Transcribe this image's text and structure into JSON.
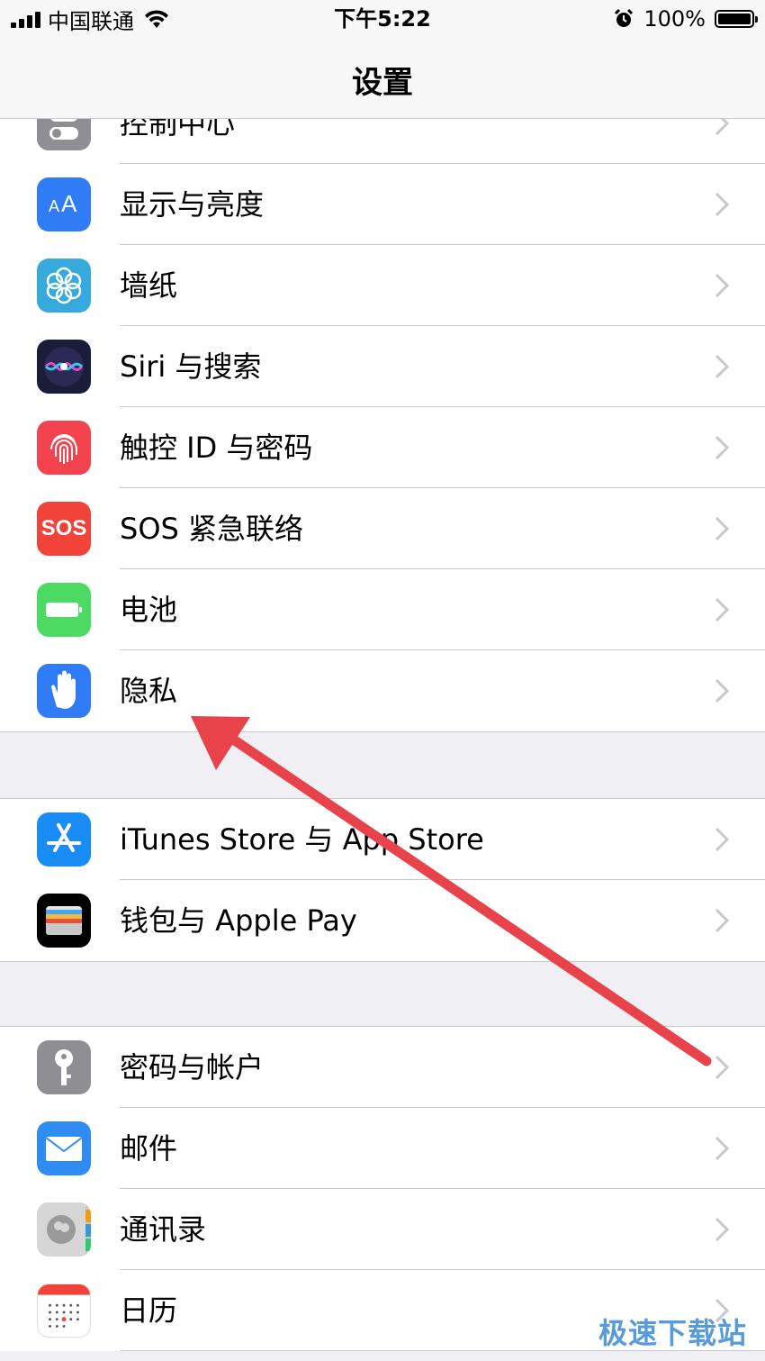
{
  "status_bar": {
    "carrier": "中国联通",
    "time": "下午5:22",
    "battery_percent": "100%",
    "battery_level": 1.0
  },
  "nav": {
    "title": "设置"
  },
  "groups": [
    {
      "items": [
        {
          "label": "控制中心",
          "icon": "control-center-icon",
          "color": "#8e8e93"
        },
        {
          "label": "显示与亮度",
          "icon": "display-brightness-icon",
          "color": "#2f7cf6"
        },
        {
          "label": "墙纸",
          "icon": "wallpaper-icon",
          "color": "#36aadc"
        },
        {
          "label": "Siri 与搜索",
          "icon": "siri-icon",
          "color": "#1c1c3a"
        },
        {
          "label": "触控 ID 与密码",
          "icon": "touch-id-icon",
          "color": "#f2434f"
        },
        {
          "label": "SOS 紧急联络",
          "icon": "sos-icon",
          "color": "#f2433a",
          "icon_text": "SOS"
        },
        {
          "label": "电池",
          "icon": "battery-icon",
          "color": "#4cd964"
        },
        {
          "label": "隐私",
          "icon": "privacy-hand-icon",
          "color": "#2f7cf6"
        }
      ]
    },
    {
      "items": [
        {
          "label": "iTunes Store 与 App Store",
          "icon": "app-store-icon",
          "color": "#1a8cf6"
        },
        {
          "label": "钱包与 Apple Pay",
          "icon": "wallet-icon",
          "color": "#000000"
        }
      ]
    },
    {
      "items": [
        {
          "label": "密码与帐户",
          "icon": "key-icon",
          "color": "#8e8e93"
        },
        {
          "label": "邮件",
          "icon": "mail-icon",
          "color": "#2f8cf2"
        },
        {
          "label": "通讯录",
          "icon": "contacts-icon",
          "color": "#c9c9c9"
        },
        {
          "label": "日历",
          "icon": "calendar-icon",
          "color": "#ffffff"
        }
      ]
    }
  ],
  "annotation": {
    "arrow_color": "#e8434a"
  },
  "watermark": "极速下载站"
}
